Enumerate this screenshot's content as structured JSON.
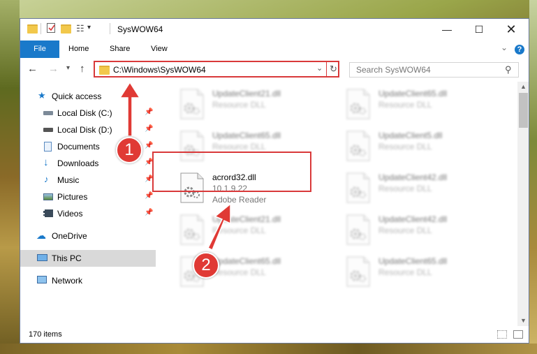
{
  "window": {
    "title": "SysWOW64"
  },
  "ribbon": {
    "tabs": [
      "File",
      "Home",
      "Share",
      "View"
    ]
  },
  "address": {
    "path": "C:\\Windows\\SysWOW64",
    "search_placeholder": "Search SysWOW64"
  },
  "nav": {
    "quick_access": "Quick access",
    "items": [
      {
        "label": "Local Disk (C:)",
        "icon": "drive-icon"
      },
      {
        "label": "Local Disk (D:)",
        "icon": "drive-icon"
      },
      {
        "label": "Documents",
        "icon": "documents-icon"
      },
      {
        "label": "Downloads",
        "icon": "downloads-icon"
      },
      {
        "label": "Music",
        "icon": "music-icon"
      },
      {
        "label": "Pictures",
        "icon": "pictures-icon"
      },
      {
        "label": "Videos",
        "icon": "videos-icon"
      }
    ],
    "onedrive": "OneDrive",
    "this_pc": "This PC",
    "network": "Network"
  },
  "files": [
    {
      "name": "UpdateClient21.dll",
      "desc": "Resource DLL"
    },
    {
      "name": "UpdateClient65.dll",
      "desc": "Resource DLL"
    },
    {
      "name": "UpdateClient65.dll",
      "desc": "Resource DLL"
    },
    {
      "name": "UpdateClient5.dll",
      "desc": "Resource DLL"
    },
    {
      "name": "acrord32.dll",
      "version": "10.1.9.22",
      "company": "Adobe Reader"
    },
    {
      "name": "UpdateClient42.dll",
      "desc": "Resource DLL"
    },
    {
      "name": "UpdateClient21.dll",
      "desc": "Resource DLL"
    },
    {
      "name": "UpdateClient42.dll",
      "desc": "Resource DLL"
    },
    {
      "name": "UpdateClient65.dll",
      "desc": "Resource DLL"
    },
    {
      "name": "UpdateClient65.dll",
      "desc": "Resource DLL"
    }
  ],
  "status": {
    "items": "170 items"
  },
  "annotations": {
    "step1": "1",
    "step2": "2",
    "color": "#e03a35"
  }
}
